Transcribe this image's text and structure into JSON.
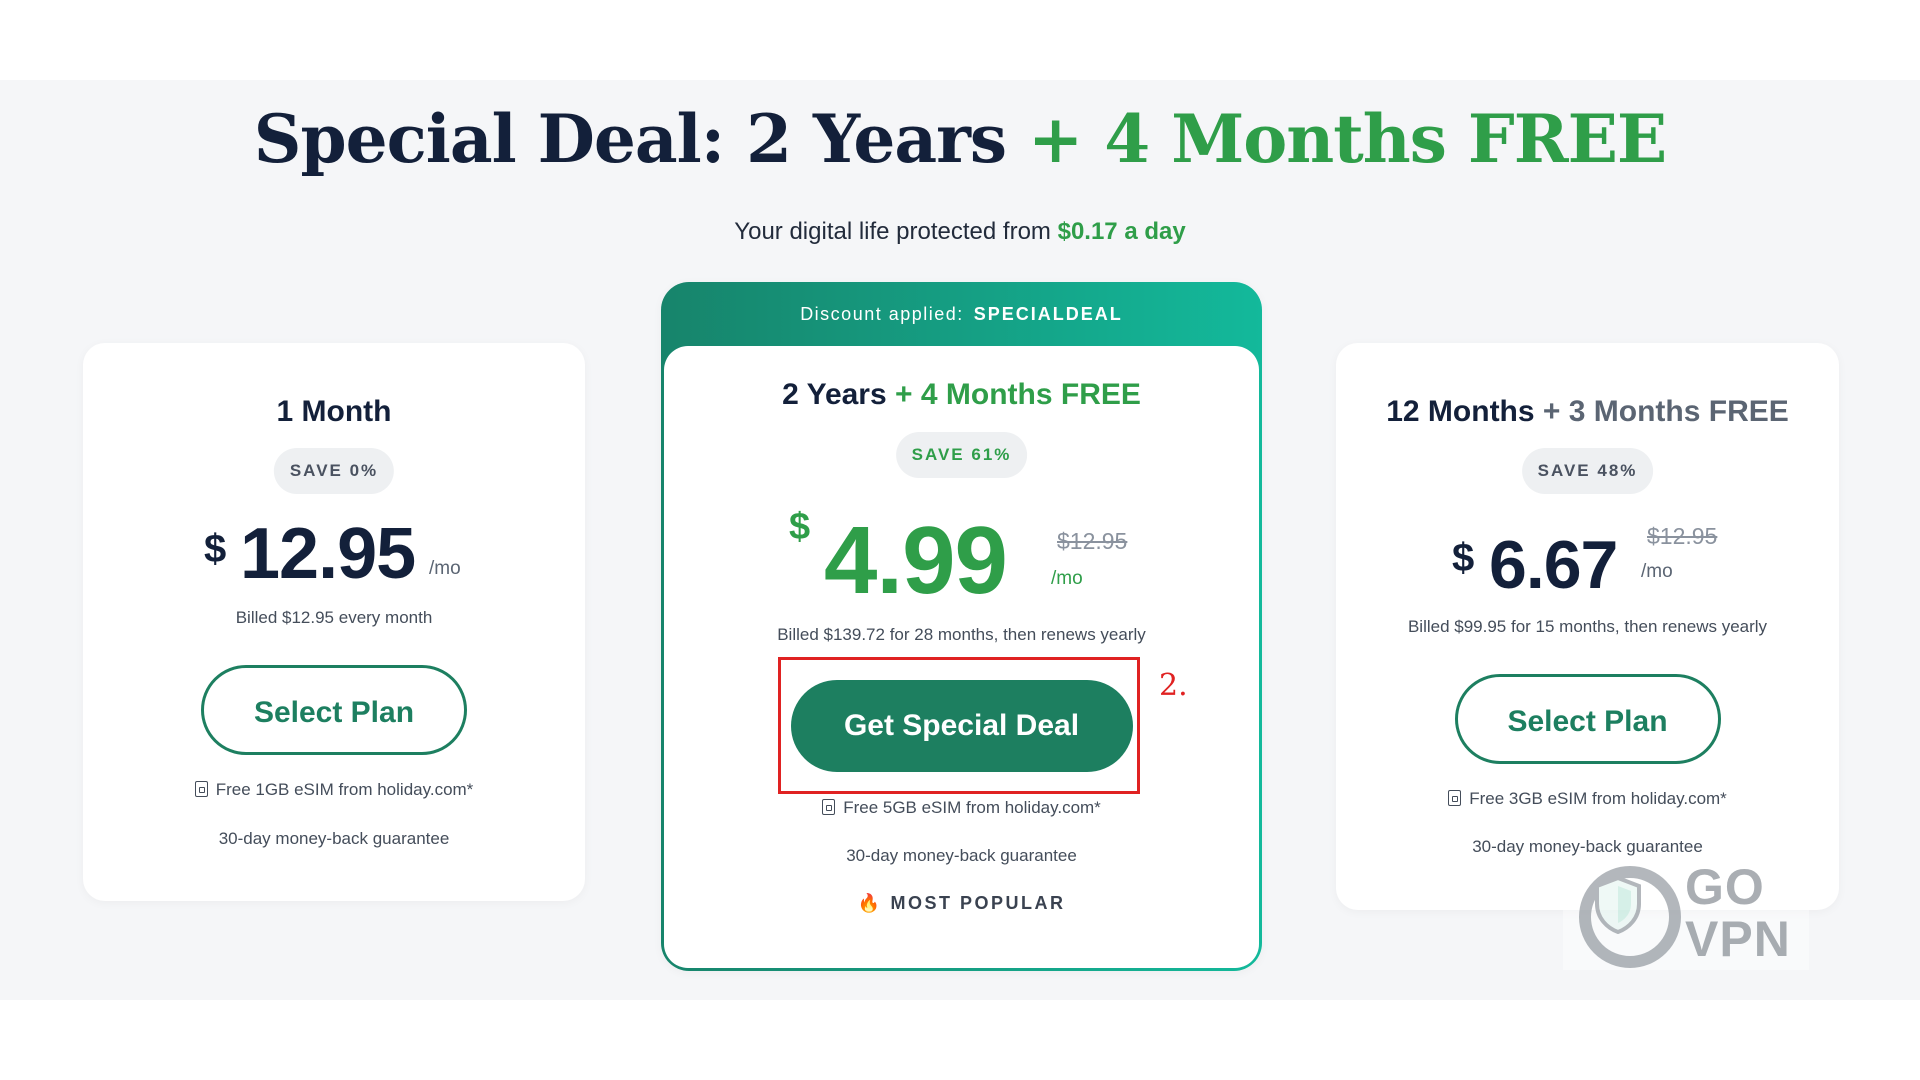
{
  "headline": {
    "main": "Special Deal: 2 Years",
    "accent": "+ 4 Months FREE"
  },
  "subline": {
    "text": "Your digital life protected from",
    "price": "$0.17 a day"
  },
  "plans": [
    {
      "title": "1 Month",
      "title_accent": "",
      "save": "SAVE 0%",
      "currency": "$",
      "price": "12.95",
      "per": "/mo",
      "old_price": "",
      "billed": "Billed $12.95 every month",
      "button": "Select Plan",
      "esim": "Free 1GB eSIM from holiday.com*",
      "guarantee": "30-day money-back guarantee"
    },
    {
      "discount_label": "Discount applied:",
      "discount_code": "SPECIALDEAL",
      "title": "2 Years",
      "title_accent": "+ 4 Months FREE",
      "save": "SAVE 61%",
      "currency": "$",
      "price": "4.99",
      "per": "/mo",
      "old_price": "$12.95",
      "billed": "Billed $139.72 for 28 months, then renews yearly",
      "button": "Get Special Deal",
      "esim": "Free 5GB eSIM from holiday.com*",
      "guarantee": "30-day money-back guarantee",
      "badge": "MOST POPULAR"
    },
    {
      "title": "12 Months",
      "title_accent": "+ 3 Months FREE",
      "save": "SAVE 48%",
      "currency": "$",
      "price": "6.67",
      "per": "/mo",
      "old_price": "$12.95",
      "billed": "Billed $99.95 for 15 months, then renews yearly",
      "button": "Select Plan",
      "esim": "Free 3GB eSIM from holiday.com*",
      "guarantee": "30-day money-back guarantee"
    }
  ],
  "annotation": {
    "step": "2."
  },
  "watermark": {
    "line1": "GO",
    "line2": "VPN"
  },
  "icons": {
    "esim": "sim-card-icon",
    "popular": "flame-icon",
    "watermark": "shield-icon"
  },
  "colors": {
    "accent_green": "#2f9e49",
    "button_green": "#1d7f60",
    "header_gradient_start": "#17846b",
    "header_gradient_end": "#13b99b",
    "annotation_red": "#e02222"
  }
}
